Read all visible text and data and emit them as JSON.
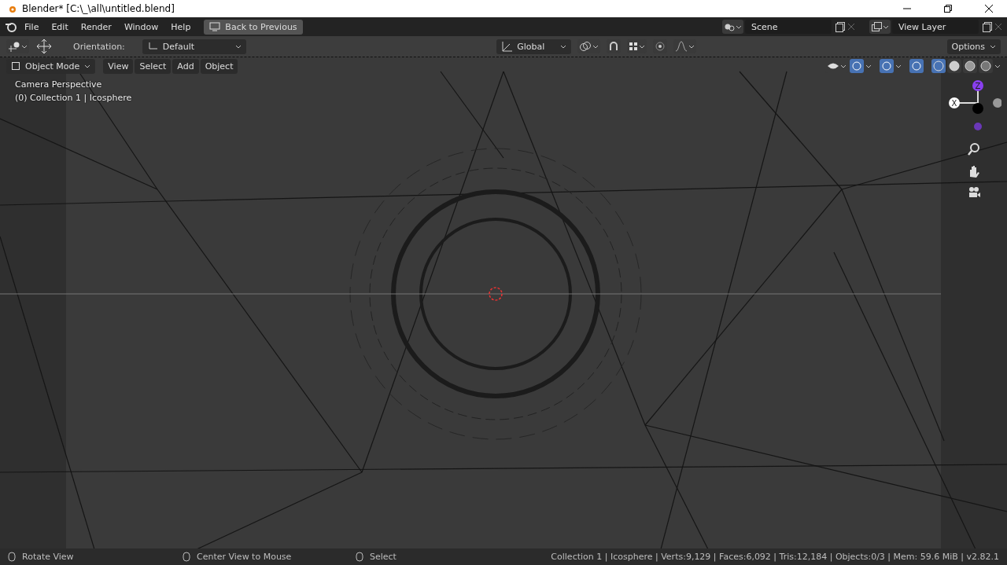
{
  "window": {
    "title": "Blender* [C:\\_\\all\\untitled.blend]"
  },
  "menu": [
    "File",
    "Edit",
    "Render",
    "Window",
    "Help"
  ],
  "back_button": "Back to Previous",
  "scene": {
    "value": "Scene"
  },
  "view_layer": {
    "value": "View Layer"
  },
  "tool_header": {
    "orientation_label": "Orientation:",
    "orientation": "Default",
    "transform": "Global",
    "options": "Options"
  },
  "viewport_header": {
    "mode": "Object Mode",
    "menus": [
      "View",
      "Select",
      "Add",
      "Object"
    ],
    "toggles": [
      {
        "on": true
      },
      {
        "on": true
      },
      {
        "on": true
      }
    ],
    "shading": [
      {
        "selected": true
      },
      {
        "selected": false
      },
      {
        "selected": false
      },
      {
        "selected": false
      }
    ]
  },
  "viewport": {
    "info": [
      "Camera Perspective",
      "(0) Collection 1 | Icosphere"
    ],
    "gizmo": {
      "z": "Z",
      "x": "X"
    }
  },
  "status_bar": {
    "hints": [
      "Rotate View",
      "Center View to Mouse",
      "Select"
    ],
    "stats": "Collection 1 | Icosphere | Verts:9,129 | Faces:6,092 | Tris:12,184 | Objects:0/3 | Mem: 59.6 MiB | v2.82.1"
  }
}
